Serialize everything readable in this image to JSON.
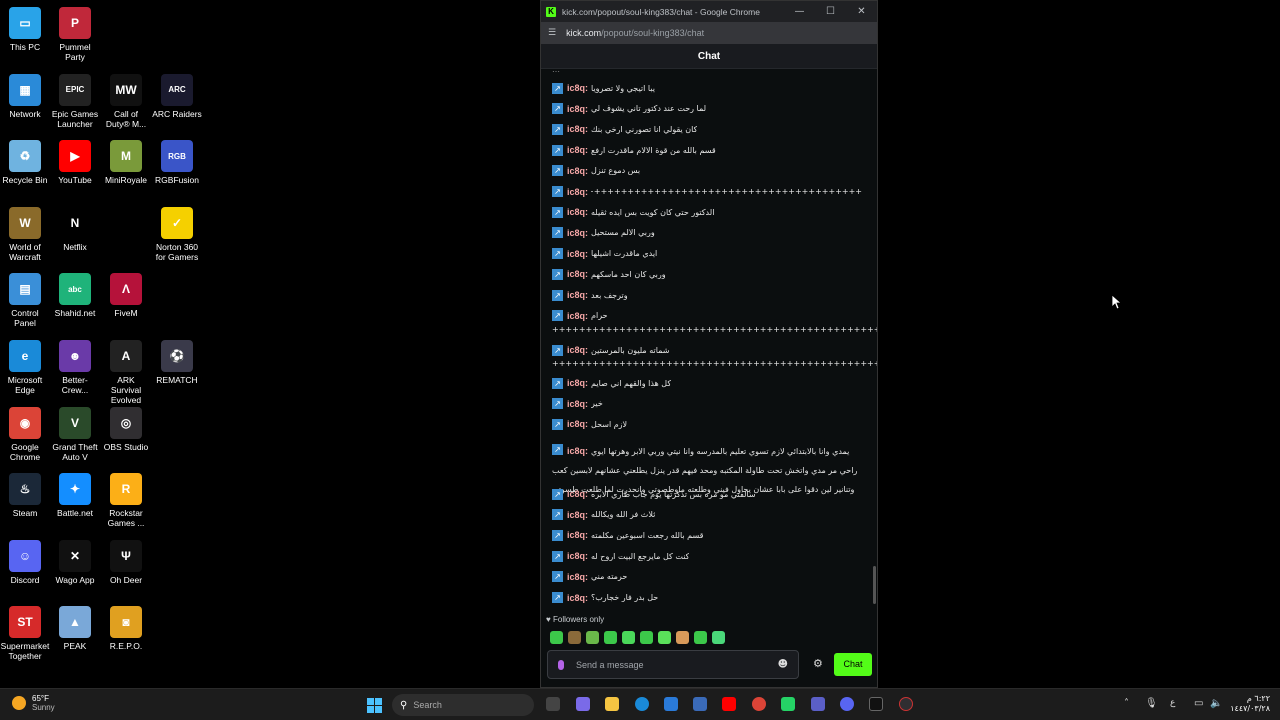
{
  "desktop_icons": [
    {
      "label": "This PC",
      "icon": "monitor-icon",
      "color": "#29a3e8",
      "glyph": "▭"
    },
    {
      "label": "Pummel Party",
      "icon": "pummel-party-icon",
      "color": "#c0283a",
      "glyph": "P"
    },
    {
      "label": "Network",
      "icon": "network-icon",
      "color": "#2a8ad8",
      "glyph": "▦"
    },
    {
      "label": "Epic Games Launcher",
      "icon": "epic-games-icon",
      "color": "#222222",
      "glyph": "EPIC"
    },
    {
      "label": "Call of Duty® M...",
      "icon": "call-of-duty-icon",
      "color": "#111111",
      "glyph": "MW"
    },
    {
      "label": "ARC Raiders",
      "icon": "arc-raiders-icon",
      "color": "#1a1a2e",
      "glyph": "ARC"
    },
    {
      "label": "Recycle Bin",
      "icon": "recycle-bin-icon",
      "color": "#6fb3e0",
      "glyph": "♻"
    },
    {
      "label": "YouTube",
      "icon": "youtube-icon",
      "color": "#ff0000",
      "glyph": "▶"
    },
    {
      "label": "MiniRoyale",
      "icon": "miniroyale-icon",
      "color": "#7a9a3a",
      "glyph": "M"
    },
    {
      "label": "RGBFusion",
      "icon": "rgbfusion-icon",
      "color": "#3a55c8",
      "glyph": "RGB"
    },
    {
      "label": "World of Warcraft",
      "icon": "world-of-warcraft-icon",
      "color": "#8a6a2a",
      "glyph": "W"
    },
    {
      "label": "Netflix",
      "icon": "netflix-icon",
      "color": "#000000",
      "glyph": "N"
    },
    {
      "label": "Norton 360 for Gamers",
      "icon": "norton-icon",
      "color": "#f5d000",
      "glyph": "✓"
    },
    {
      "label": "Control Panel",
      "icon": "control-panel-icon",
      "color": "#3a8fd8",
      "glyph": "▤"
    },
    {
      "label": "Shahid.net",
      "icon": "shahid-icon",
      "color": "#1fb37a",
      "glyph": "abc"
    },
    {
      "label": "FiveM",
      "icon": "fivem-icon",
      "color": "#b5123a",
      "glyph": "Λ"
    },
    {
      "label": "Microsoft Edge",
      "icon": "edge-icon",
      "color": "#1a8ad8",
      "glyph": "e"
    },
    {
      "label": "Better-Crew...",
      "icon": "better-crewlink-icon",
      "color": "#6a3aa8",
      "glyph": "☻"
    },
    {
      "label": "ARK Survival Evolved",
      "icon": "ark-icon",
      "color": "#222222",
      "glyph": "A"
    },
    {
      "label": "REMATCH",
      "icon": "rematch-icon",
      "color": "#3a3a4a",
      "glyph": "⚽"
    },
    {
      "label": "Google Chrome",
      "icon": "chrome-icon",
      "color": "#db4437",
      "glyph": "◉"
    },
    {
      "label": "Grand Theft Auto V",
      "icon": "gta-icon",
      "color": "#2a4a2a",
      "glyph": "V"
    },
    {
      "label": "OBS Studio",
      "icon": "obs-icon",
      "color": "#302e31",
      "glyph": "◎"
    },
    {
      "label": "Steam",
      "icon": "steam-icon",
      "color": "#1b2838",
      "glyph": "♨"
    },
    {
      "label": "Battle.net",
      "icon": "battlenet-icon",
      "color": "#148eff",
      "glyph": "✦"
    },
    {
      "label": "Rockstar Games ...",
      "icon": "rockstar-icon",
      "color": "#fcaf17",
      "glyph": "R"
    },
    {
      "label": "Discord",
      "icon": "discord-icon",
      "color": "#5865f2",
      "glyph": "☺"
    },
    {
      "label": "Wago App",
      "icon": "wago-icon",
      "color": "#111111",
      "glyph": "✕"
    },
    {
      "label": "Oh Deer",
      "icon": "oh-deer-icon",
      "color": "#111111",
      "glyph": "Ψ"
    },
    {
      "label": "Supermarket Together",
      "icon": "supermarket-icon",
      "color": "#d62a2a",
      "glyph": "ST"
    },
    {
      "label": "PEAK",
      "icon": "peak-icon",
      "color": "#7aa8d8",
      "glyph": "▲"
    },
    {
      "label": "R.E.P.O.",
      "icon": "repo-icon",
      "color": "#e0a020",
      "glyph": "◙"
    }
  ],
  "browser": {
    "window_title": "kick.com/popout/soul-king383/chat - Google Chrome",
    "favicon": "K",
    "url_host": "kick.com",
    "url_path": "/popout/soul-king383/chat",
    "header": "Chat",
    "minimize": "—",
    "maximize": "☐",
    "close": "✕"
  },
  "chat": {
    "username": "ic8q:",
    "messages": [
      "يبا اتيجي ولا تصرويا",
      "لما رحت عند دكتور تاني يشوف لي",
      "كان يقولي انا تصورني ارخي بنك",
      "قسم بالله من قوة الالام ماقدرت ارفع",
      "بس دموع تنزل",
      "+++++++++++++++++++++++++++++++++++++++++++++++++++++++++++++++++++++++++++++++",
      "الدكتور حتي كان كويت بس ايده ثقيله",
      "وربي الالم مستحيل",
      "ايدي ماقدرت اشيلها",
      "وربي كان احد ماسكهم",
      "وترجف بعد",
      "حرام"
    ],
    "plus_line": "+++++++++++++++++++++++++++++++++++++++++++++++++++++++++++++++++++++++++++",
    "plus_line2": "+++++++++++++++++++++++++++++++++++++++++++++++++++++++++++++++++++++++++++",
    "message_between": "شماته مليون بالمرستين",
    "messages2": [
      "كل هذا والقهم اني صايم",
      "خير",
      "لازم اسحل"
    ],
    "long_message": "يمدي وانا بالابتدائي لازم تسوي تعليم بالمدرسه وانا نيتي وربي الابر وهرتها ايوي راحي مر مدي واتخش تحت طاولة المكتبه ومحد فيهم قدر ينزل يطلعني عشانهم لابسين كعب وتنانير لين دقوا على بابا عشان يحاول فيني وطلعته ماوطصوتي وانحدرت لما طلعت طسوتي",
    "messages3": [
      "سالفتي مو مره بس تذكرتها يوم جاب طاري الابره",
      "ثلاث فر الله ويكالله",
      "قسم بالله رجعت اسبوعين مكلمته",
      "كنت كل مايرجع البيت اروح له",
      "حرمته مني",
      "حل بدر فار خجارب؟"
    ],
    "followers_only": "Followers only",
    "input_placeholder": "Send a message",
    "chat_button": "Chat"
  },
  "taskbar": {
    "temperature": "65°F",
    "condition": "Sunny",
    "search_label": "Search",
    "clock_time": "٦:٢٢ م",
    "clock_date": "١٤٤٧/٠٣/٢٨"
  }
}
